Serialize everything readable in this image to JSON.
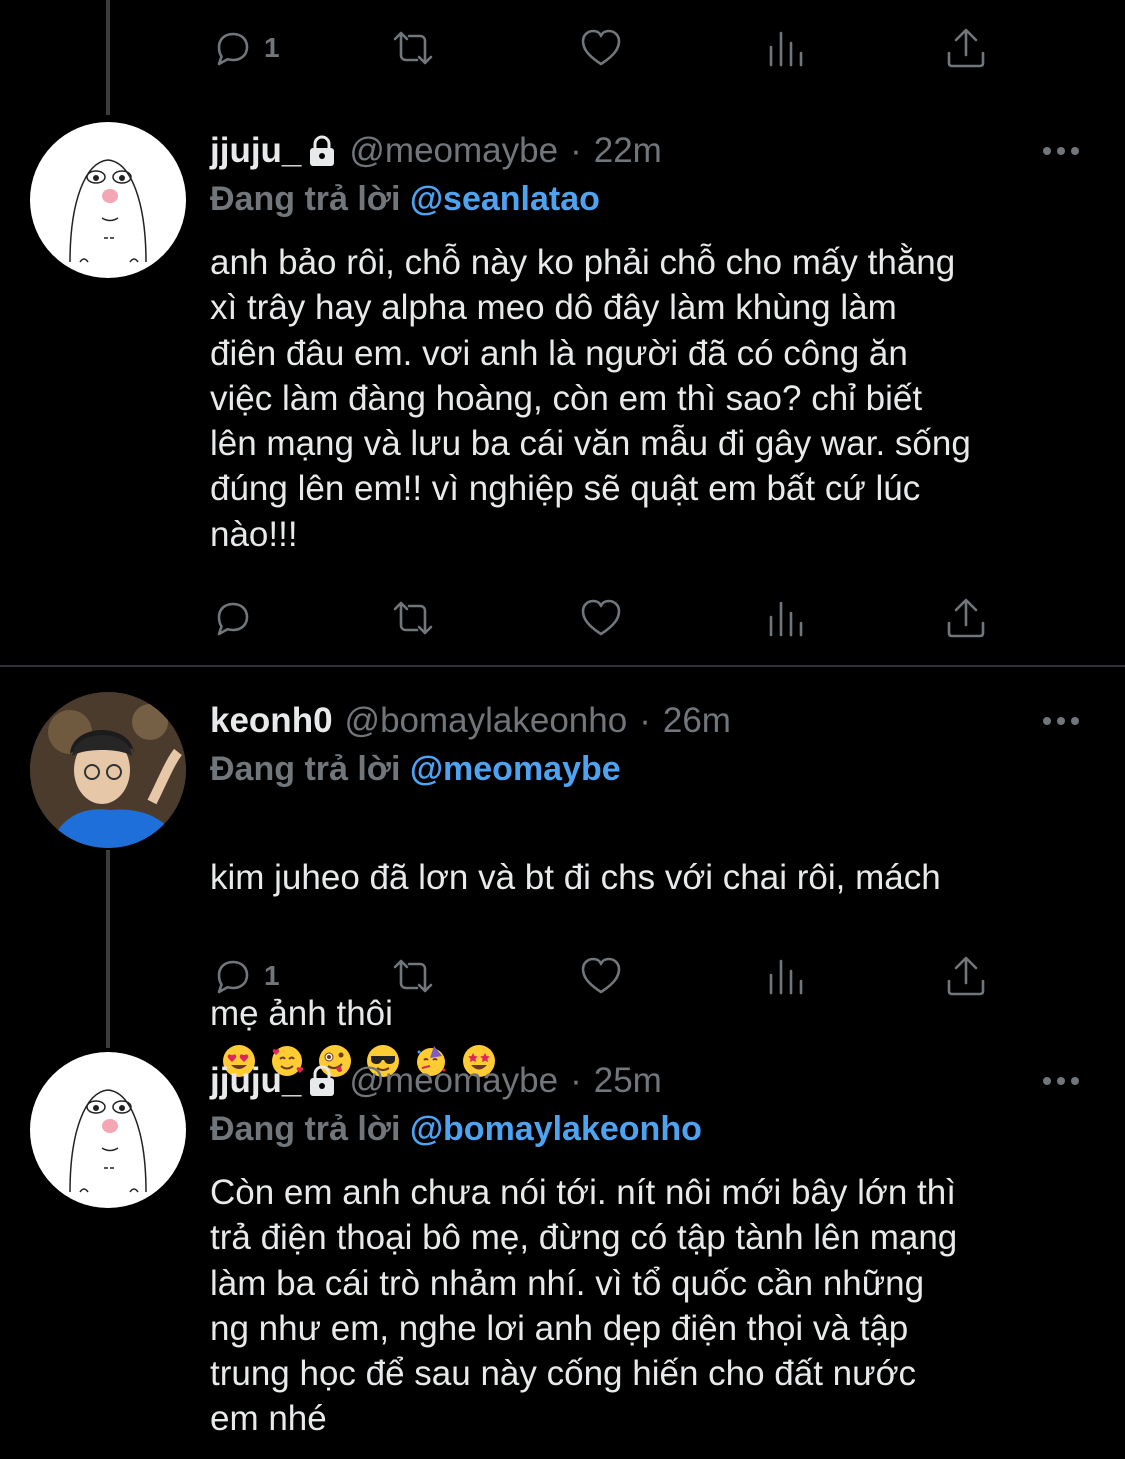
{
  "tweets": [
    {
      "name": "",
      "handle": "",
      "time": "",
      "replying_prefix": "",
      "replying_to": "",
      "text": "",
      "reply_count": "1"
    },
    {
      "name": "jjuju_",
      "handle": "@meomaybe",
      "time": "22m",
      "replying_prefix": "Đang trả lời",
      "replying_to": "@seanlatao",
      "text": "anh bảo rôi, chỗ này ko phải chỗ cho mấy thằng\nxì trây hay alpha meo dô đây làm khùng làm\nđiên đâu em. vơi anh là người đã có công ăn\nviệc làm đàng hoàng, còn em thì sao? chỉ biết\nlên mạng và lưu ba cái văn mẫu đi gây war. sống\nđúng lên em!! vì nghiệp sẽ quật em bất cứ lúc\nnào!!!",
      "reply_count": ""
    },
    {
      "name": "keonh0",
      "handle": "@bomaylakeonho",
      "time": "26m",
      "replying_prefix": "Đang trả lời",
      "replying_to": "@meomaybe",
      "text_line1": "kim juheo đã lơn và bt đi chs với chai rôi, mách",
      "text_line2": "mẹ ảnh thôi",
      "emojis": [
        "heart-eyes",
        "smiling-hearts",
        "zany",
        "sunglasses",
        "partying",
        "star-struck"
      ],
      "reply_count": "1"
    },
    {
      "name": "jjuju_",
      "handle": "@meomaybe",
      "time": "25m",
      "replying_prefix": "Đang trả lời",
      "replying_to": "@bomaylakeonho",
      "text": "Còn em anh chưa nói tới. nít nôi mới bây lớn thì\ntrả điện thoại bô mẹ, đừng có tập tành lên mạng\nlàm ba cái trò nhảm nhí. vì tổ quốc cần những\nng như em, nghe lơi anh dẹp điện thọi và tập\ntrung học để sau này cống hiến cho đất nước\nem nhé"
    }
  ],
  "icons": {
    "reply": "reply-icon",
    "retweet": "retweet-icon",
    "like": "heart-icon",
    "analytics": "analytics-icon",
    "share": "share-icon",
    "more": "more-icon",
    "lock": "lock-icon"
  },
  "colors": {
    "background": "#000000",
    "text": "#e7e9ea",
    "muted": "#71767b",
    "mention": "#4ea3f1"
  }
}
